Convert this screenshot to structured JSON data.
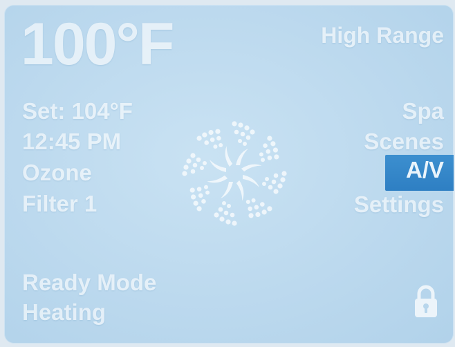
{
  "display": {
    "temperature": "100°F",
    "range": "High Range",
    "set_point": "Set: 104°F",
    "time": "12:45 PM",
    "ozone": "Ozone",
    "filter": "Filter 1",
    "mode": "Ready Mode",
    "status": "Heating"
  },
  "menu": {
    "items": [
      {
        "label": "Spa",
        "selected": false
      },
      {
        "label": "Scenes",
        "selected": false
      },
      {
        "label": "A/V",
        "selected": true
      },
      {
        "label": "Settings",
        "selected": false
      }
    ]
  },
  "icons": {
    "center": "swirl-jets-icon",
    "lock": "lock-icon"
  },
  "colors": {
    "background": "#bcd9ee",
    "text": "#ffffff",
    "highlight": "#2e7fc3"
  }
}
